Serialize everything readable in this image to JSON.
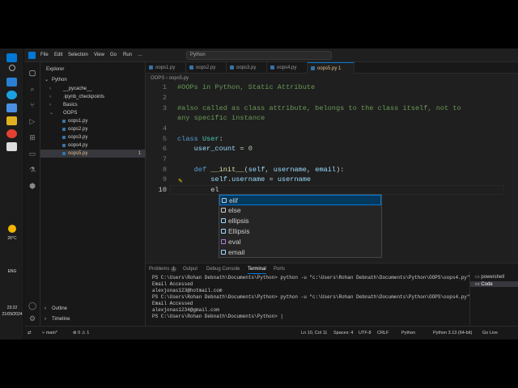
{
  "taskbar": {
    "weather_temp": "28°C",
    "lang": "ENG",
    "time": "23:22",
    "date": "21/09/2024"
  },
  "titlebar": {
    "menu": [
      "File",
      "Edit",
      "Selection",
      "View",
      "Go",
      "Run",
      "…"
    ],
    "command_center": "Python"
  },
  "sidebar": {
    "header": "Explorer",
    "root_folder": "Python",
    "items": [
      {
        "label": "__pycache__",
        "type": "folder"
      },
      {
        "label": ".ipynb_checkpoints",
        "type": "folder"
      },
      {
        "label": "Basics",
        "type": "folder"
      },
      {
        "label": "OOPS",
        "type": "folder-open"
      },
      {
        "label": "oops1.py",
        "type": "file"
      },
      {
        "label": "oops2.py",
        "type": "file"
      },
      {
        "label": "oops3.py",
        "type": "file"
      },
      {
        "label": "oops4.py",
        "type": "file"
      },
      {
        "label": "oops5.py",
        "type": "file",
        "active": true,
        "badge": "1"
      }
    ],
    "outline": "Outline",
    "timeline": "Timeline"
  },
  "editor": {
    "tabs": [
      "oops1.py",
      "oops2.py",
      "oops3.py",
      "oops4.py",
      "oops5.py"
    ],
    "active_tab_badge": "1",
    "breadcrumb": [
      "OOPS",
      "oops5.py"
    ],
    "lines": [
      {
        "n": "1",
        "text": "#OOPs in Python, Static Attribute"
      },
      {
        "n": "2",
        "text": ""
      },
      {
        "n": "3",
        "text": "#also called as class attribute, belongs to the class itself, not to"
      },
      {
        "n": "",
        "text": "any specific instance"
      },
      {
        "n": "4",
        "text": ""
      },
      {
        "n": "5",
        "text": "class User:"
      },
      {
        "n": "6",
        "text": "    user_count = 0"
      },
      {
        "n": "7",
        "text": ""
      },
      {
        "n": "8",
        "text": "    def __init__(self, username, email):"
      },
      {
        "n": "9",
        "text": "        self.username = username"
      },
      {
        "n": "10",
        "text": "        el"
      }
    ],
    "suggestions": [
      "elif",
      "else",
      "ellipsis",
      "Ellipsis",
      "eval",
      "email"
    ]
  },
  "panel": {
    "tabs": [
      "Problems",
      "Output",
      "Debug Console",
      "Terminal",
      "Ports"
    ],
    "problems_badge": "1",
    "active_tab": "Terminal",
    "terminal_lines": [
      "PS C:\\Users\\Rohan Debnath\\Documents\\Python> python -u \"c:\\Users\\Rohan Debnath\\Documents\\Python\\OOPS\\oops4.py\"",
      "Email Accessed",
      "alexjonas123@hotmail.com",
      "PS C:\\Users\\Rohan Debnath\\Documents\\Python> python -u \"c:\\Users\\Rohan Debnath\\Documents\\Python\\OOPS\\oops4.py\"",
      "Email Accessed",
      "alexjonas1234@gmail.com",
      "PS C:\\Users\\Rohan Debnath\\Documents\\Python> |"
    ],
    "shells": [
      "powershell",
      "Code"
    ]
  },
  "statusbar": {
    "branch": "main*",
    "errors": "0",
    "warnings": "1",
    "position": "Ln 10, Col 11",
    "spaces": "Spaces: 4",
    "encoding": "UTF-8",
    "eol": "CRLF",
    "language": "Python",
    "interpreter": "Python 3.13 (64-bit)",
    "golive": "Go Live"
  }
}
